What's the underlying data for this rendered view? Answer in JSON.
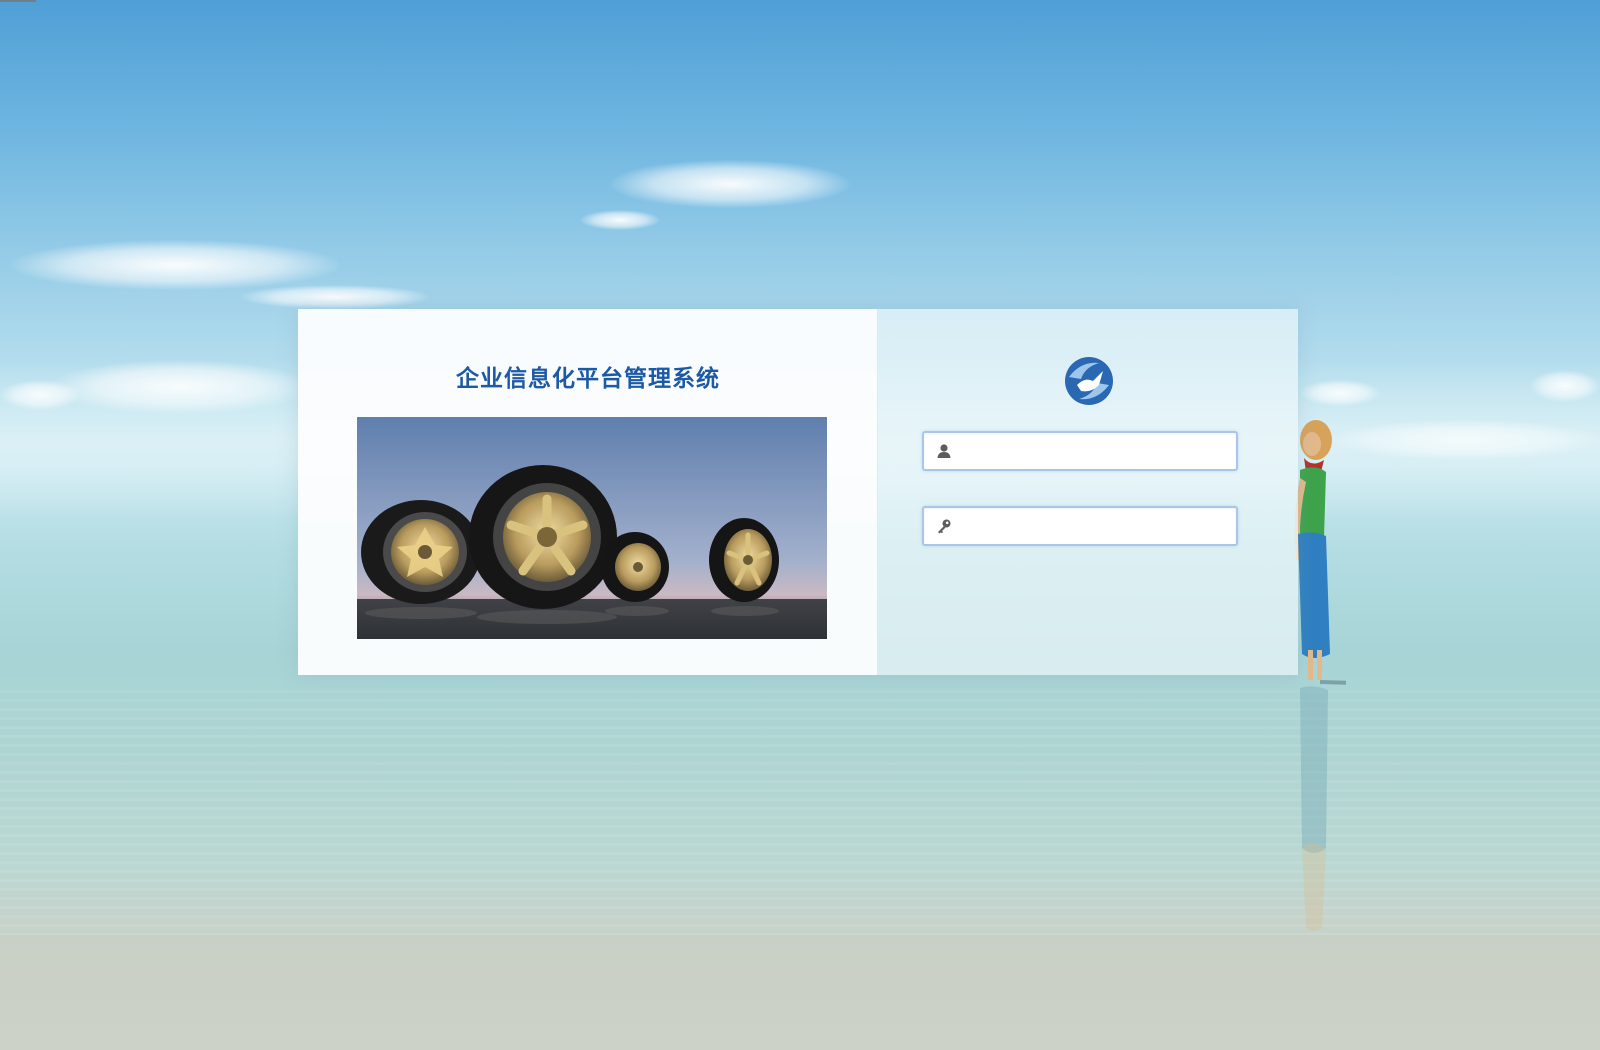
{
  "page": {
    "title": "企业信息化平台管理系统"
  },
  "login": {
    "username": {
      "value": "",
      "placeholder": "",
      "icon": "user-icon"
    },
    "password": {
      "value": "",
      "placeholder": "",
      "icon": "key-icon"
    },
    "logo_icon": "bird-globe-logo-icon"
  },
  "hero_image": {
    "subject": "tires-wheels-image"
  },
  "colors": {
    "title_blue": "#1d5aa5",
    "field_border": "#a9c6e6",
    "logo_blue": "#1f5fae"
  }
}
